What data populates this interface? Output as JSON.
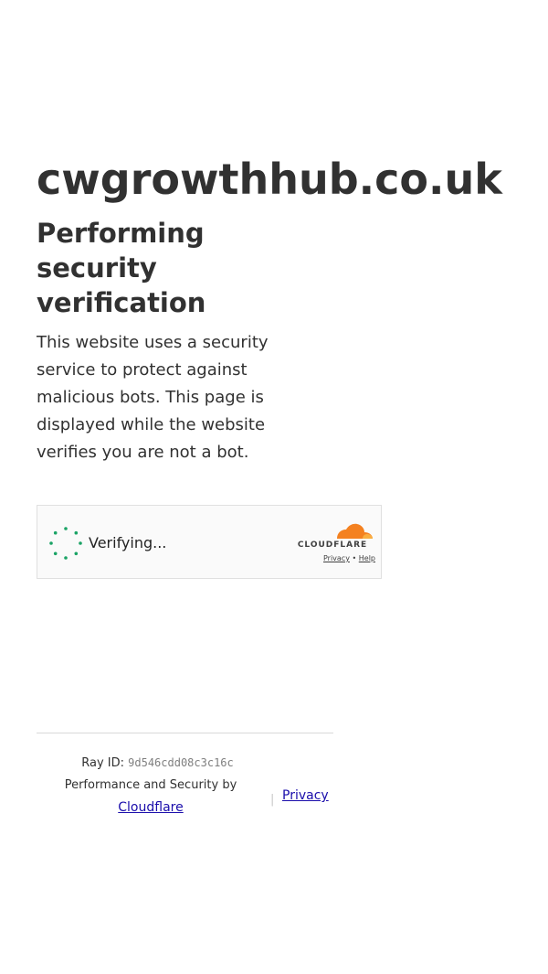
{
  "site": {
    "domain": "cwgrowthhub.co.uk"
  },
  "challenge": {
    "heading": "Performing security verification",
    "description": "This website uses a security service to protect against malicious bots. This page is displayed while the website verifies you are not a bot."
  },
  "widget": {
    "status": "Verifying...",
    "brand": "CLOUDFLARE",
    "privacy_label": "Privacy",
    "separator": "•",
    "help_label": "Help",
    "spinner_icon": "spinner-icon",
    "logo_icon": "cloudflare-cloud-icon",
    "accent_color": "#f48120",
    "spinner_color": "#1aa365"
  },
  "footer": {
    "ray_label": "Ray ID:",
    "ray_id": "9d546cdd08c3c16c",
    "performance_text": "Performance and Security by",
    "cloudflare_link": "Cloudflare",
    "pipe": "|",
    "privacy_link": "Privacy",
    "link_color": "#1a0dab"
  }
}
